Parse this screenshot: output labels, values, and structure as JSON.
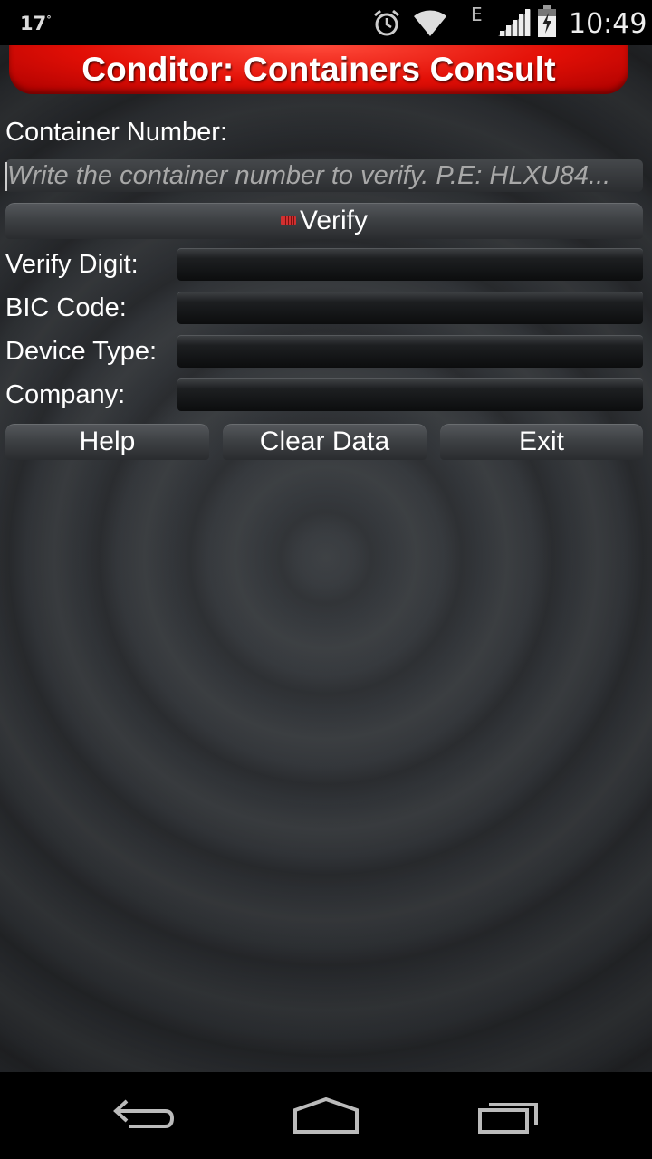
{
  "status_bar": {
    "temperature": "17",
    "degree": "°",
    "network_type": "E",
    "time": "10:49",
    "icons": [
      "alarm-icon",
      "wifi-icon",
      "signal-icon",
      "battery-charging-icon"
    ]
  },
  "app": {
    "title": "Conditor: Containers Consult",
    "colors": {
      "title_red": "#e20f06",
      "background": "#33363a"
    },
    "container_number": {
      "label": "Container Number:",
      "value": "",
      "placeholder": "Write the container number to verify. P.E: HLXU84..."
    },
    "verify_button": {
      "label": "Verify",
      "icon": "barcode-icon"
    },
    "fields": {
      "verify_digit": {
        "label": "Verify Digit:",
        "value": ""
      },
      "bic_code": {
        "label": "BIC Code:",
        "value": ""
      },
      "device_type": {
        "label": "Device Type:",
        "value": ""
      },
      "company": {
        "label": "Company:",
        "value": ""
      }
    },
    "buttons": {
      "help": "Help",
      "clear_data": "Clear Data",
      "exit": "Exit"
    }
  },
  "nav_bar": {
    "icons": [
      "back-icon",
      "home-icon",
      "recent-apps-icon"
    ]
  }
}
